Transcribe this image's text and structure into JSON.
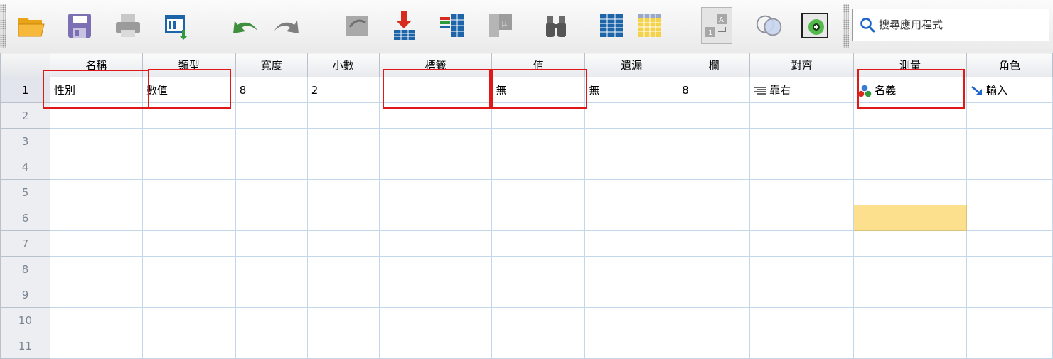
{
  "toolbar": {
    "buttons": [
      {
        "name": "open-folder-icon"
      },
      {
        "name": "save-icon"
      },
      {
        "name": "print-icon"
      },
      {
        "name": "dialog-recall-icon"
      },
      {
        "name": "undo-icon"
      },
      {
        "name": "redo-icon"
      },
      {
        "name": "goto-case-icon"
      },
      {
        "name": "goto-variable-icon"
      },
      {
        "name": "variables-icon"
      },
      {
        "name": "value-labels-icon"
      },
      {
        "name": "find-icon"
      },
      {
        "name": "insert-cases-icon"
      },
      {
        "name": "insert-variable-icon"
      },
      {
        "name": "split-file-icon"
      },
      {
        "name": "use-sets-icon"
      },
      {
        "name": "show-all-variables-icon"
      }
    ],
    "search_placeholder": "搜尋應用程式"
  },
  "grid": {
    "columns": [
      "名稱",
      "類型",
      "寬度",
      "小數",
      "標籤",
      "值",
      "遺漏",
      "欄",
      "對齊",
      "測量",
      "角色"
    ],
    "row_numbers": [
      "1",
      "2",
      "3",
      "4",
      "5",
      "6",
      "7",
      "8",
      "9",
      "10",
      "11"
    ],
    "row1": {
      "name": "性別",
      "type": "數值",
      "width": "8",
      "decimals": "2",
      "label": "",
      "values": "無",
      "missing": "無",
      "columns": "8",
      "align": "靠右",
      "measure": "名義",
      "role": "輸入"
    }
  },
  "colors": {
    "annotation_red": "#e01818",
    "selection_highlight": "#fce08e"
  }
}
